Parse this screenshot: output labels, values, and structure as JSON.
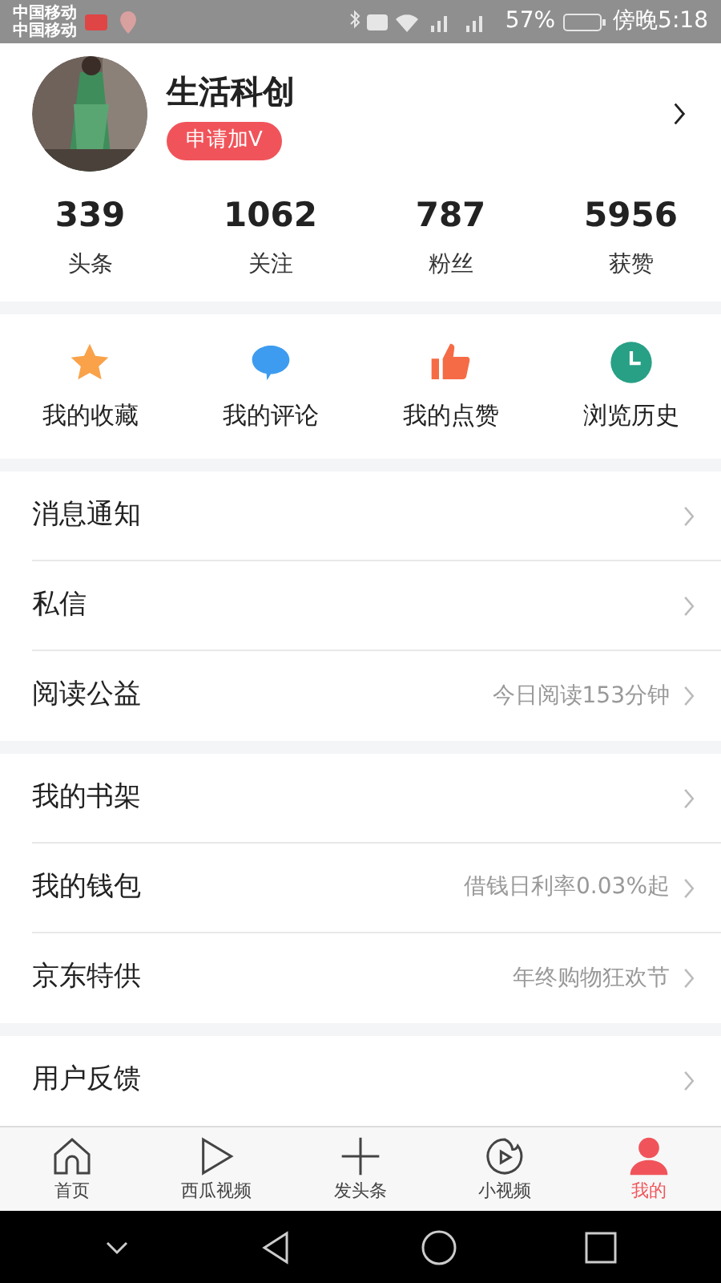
{
  "status_bar": {
    "carriers": [
      "中国移动",
      "中国移动"
    ],
    "battery": "57%",
    "time": "傍晚5:18"
  },
  "profile": {
    "name": "生活科创",
    "verify_button": "申请加V"
  },
  "stats": [
    {
      "value": "339",
      "label": "头条"
    },
    {
      "value": "1062",
      "label": "关注"
    },
    {
      "value": "787",
      "label": "粉丝"
    },
    {
      "value": "5956",
      "label": "获赞"
    }
  ],
  "shortcuts": [
    {
      "kind": "star",
      "label": "我的收藏",
      "color": "#f9a24a"
    },
    {
      "kind": "comment",
      "label": "我的评论",
      "color": "#3d9cf0"
    },
    {
      "kind": "like",
      "label": "我的点赞",
      "color": "#f56b45"
    },
    {
      "kind": "history",
      "label": "浏览历史",
      "color": "#27a085"
    }
  ],
  "menu_groups": [
    [
      {
        "label": "消息通知"
      },
      {
        "label": "私信"
      },
      {
        "label": "阅读公益",
        "detail": "今日阅读153分钟"
      }
    ],
    [
      {
        "label": "我的书架"
      },
      {
        "label": "我的钱包",
        "detail": "借钱日利率0.03%起"
      },
      {
        "label": "京东特供",
        "detail": "年终购物狂欢节"
      }
    ],
    [
      {
        "label": "用户反馈"
      }
    ]
  ],
  "tab_bar": [
    {
      "kind": "home",
      "label": "首页",
      "selected": false
    },
    {
      "kind": "play",
      "label": "西瓜视频",
      "selected": false
    },
    {
      "kind": "plus",
      "label": "发头条",
      "selected": false
    },
    {
      "kind": "flame",
      "label": "小视频",
      "selected": false
    },
    {
      "kind": "person",
      "label": "我的",
      "selected": true
    }
  ]
}
